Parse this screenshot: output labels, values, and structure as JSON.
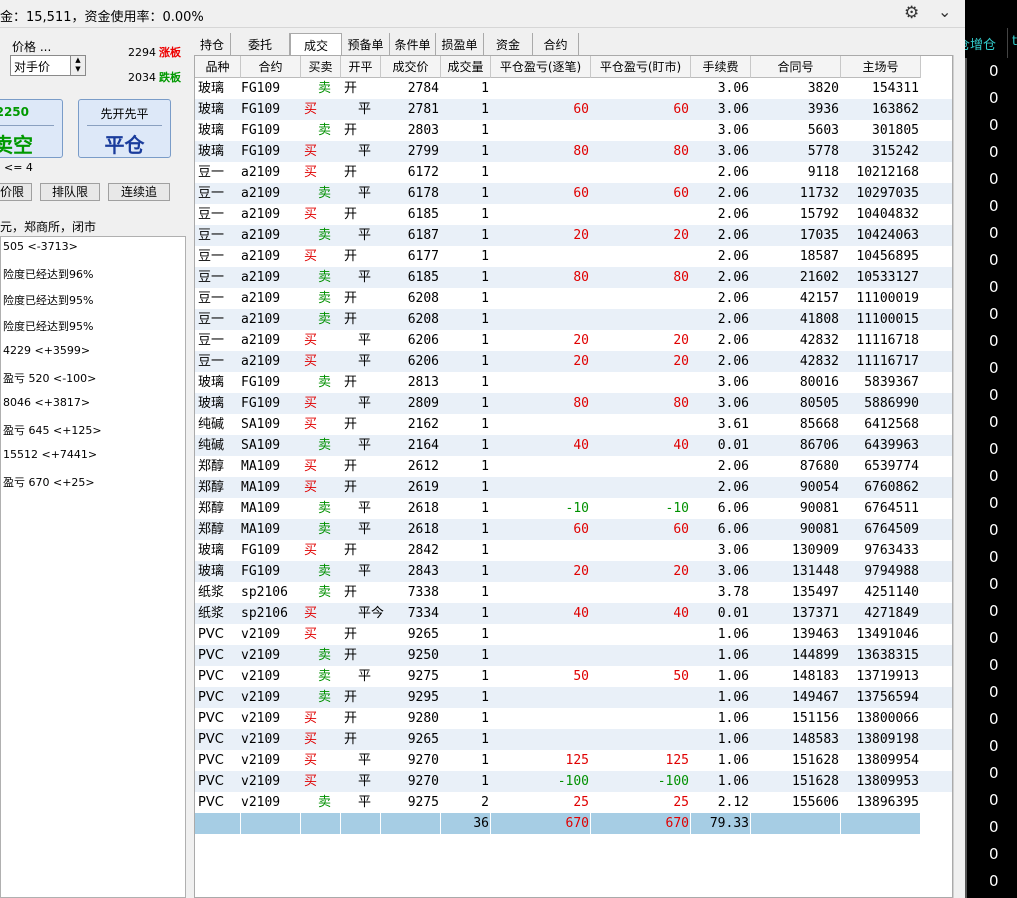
{
  "header": {
    "funds_text": "金：15,511，资金使用率：0.00%"
  },
  "order": {
    "price_label": "价格 ...",
    "price_type": "对手价",
    "limit_up_value": "2294",
    "limit_up_tag": "涨板",
    "limit_down_value": "2034",
    "limit_down_tag": "跌板",
    "sell_price": "2250",
    "sell_label": "卖空",
    "close_sub": "先开先平",
    "close_label": "平仓",
    "qty_hint": "<= 4",
    "btn_limit": "价限",
    "btn_queue": "排队限",
    "btn_chase": "连续追"
  },
  "log": {
    "header": "元，郑商所，闭市",
    "lines": [
      "505 <-3713>",
      "险度已经达到96%",
      "险度已经达到95%",
      "险度已经达到95%",
      "4229 <+3599>",
      "盈亏 520 <-100>",
      "8046 <+3817>",
      "盈亏 645 <+125>",
      "15512 <+7441>",
      "盈亏 670 <+25>"
    ]
  },
  "tabs": [
    "持仓",
    "委托",
    "成交",
    "预备单",
    "条件单",
    "损盈单",
    "资金",
    "合约"
  ],
  "active_tab": "成交",
  "columns": [
    "品种",
    "合约",
    "买卖",
    "开平",
    "成交价",
    "成交量",
    "平仓盈亏(逐笔)",
    "平仓盈亏(盯市)",
    "手续费",
    "合同号",
    "主场号"
  ],
  "rows": [
    [
      "玻璃",
      "FG109",
      "卖",
      "开",
      "2784",
      "1",
      "",
      "",
      "3.06",
      "3820",
      "154311"
    ],
    [
      "玻璃",
      "FG109",
      "买",
      "平",
      "2781",
      "1",
      "60",
      "60",
      "3.06",
      "3936",
      "163862"
    ],
    [
      "玻璃",
      "FG109",
      "卖",
      "开",
      "2803",
      "1",
      "",
      "",
      "3.06",
      "5603",
      "301805"
    ],
    [
      "玻璃",
      "FG109",
      "买",
      "平",
      "2799",
      "1",
      "80",
      "80",
      "3.06",
      "5778",
      "315242"
    ],
    [
      "豆一",
      "a2109",
      "买",
      "开",
      "6172",
      "1",
      "",
      "",
      "2.06",
      "9118",
      "10212168"
    ],
    [
      "豆一",
      "a2109",
      "卖",
      "平",
      "6178",
      "1",
      "60",
      "60",
      "2.06",
      "11732",
      "10297035"
    ],
    [
      "豆一",
      "a2109",
      "买",
      "开",
      "6185",
      "1",
      "",
      "",
      "2.06",
      "15792",
      "10404832"
    ],
    [
      "豆一",
      "a2109",
      "卖",
      "平",
      "6187",
      "1",
      "20",
      "20",
      "2.06",
      "17035",
      "10424063"
    ],
    [
      "豆一",
      "a2109",
      "买",
      "开",
      "6177",
      "1",
      "",
      "",
      "2.06",
      "18587",
      "10456895"
    ],
    [
      "豆一",
      "a2109",
      "卖",
      "平",
      "6185",
      "1",
      "80",
      "80",
      "2.06",
      "21602",
      "10533127"
    ],
    [
      "豆一",
      "a2109",
      "卖",
      "开",
      "6208",
      "1",
      "",
      "",
      "2.06",
      "42157",
      "11100019"
    ],
    [
      "豆一",
      "a2109",
      "卖",
      "开",
      "6208",
      "1",
      "",
      "",
      "2.06",
      "41808",
      "11100015"
    ],
    [
      "豆一",
      "a2109",
      "买",
      "平",
      "6206",
      "1",
      "20",
      "20",
      "2.06",
      "42832",
      "11116718"
    ],
    [
      "豆一",
      "a2109",
      "买",
      "平",
      "6206",
      "1",
      "20",
      "20",
      "2.06",
      "42832",
      "11116717"
    ],
    [
      "玻璃",
      "FG109",
      "卖",
      "开",
      "2813",
      "1",
      "",
      "",
      "3.06",
      "80016",
      "5839367"
    ],
    [
      "玻璃",
      "FG109",
      "买",
      "平",
      "2809",
      "1",
      "80",
      "80",
      "3.06",
      "80505",
      "5886990"
    ],
    [
      "纯碱",
      "SA109",
      "买",
      "开",
      "2162",
      "1",
      "",
      "",
      "3.61",
      "85668",
      "6412568"
    ],
    [
      "纯碱",
      "SA109",
      "卖",
      "平",
      "2164",
      "1",
      "40",
      "40",
      "0.01",
      "86706",
      "6439963"
    ],
    [
      "郑醇",
      "MA109",
      "买",
      "开",
      "2612",
      "1",
      "",
      "",
      "2.06",
      "87680",
      "6539774"
    ],
    [
      "郑醇",
      "MA109",
      "买",
      "开",
      "2619",
      "1",
      "",
      "",
      "2.06",
      "90054",
      "6760862"
    ],
    [
      "郑醇",
      "MA109",
      "卖",
      "平",
      "2618",
      "1",
      "-10",
      "-10",
      "6.06",
      "90081",
      "6764511"
    ],
    [
      "郑醇",
      "MA109",
      "卖",
      "平",
      "2618",
      "1",
      "60",
      "60",
      "6.06",
      "90081",
      "6764509"
    ],
    [
      "玻璃",
      "FG109",
      "买",
      "开",
      "2842",
      "1",
      "",
      "",
      "3.06",
      "130909",
      "9763433"
    ],
    [
      "玻璃",
      "FG109",
      "卖",
      "平",
      "2843",
      "1",
      "20",
      "20",
      "3.06",
      "131448",
      "9794988"
    ],
    [
      "纸浆",
      "sp2106",
      "卖",
      "开",
      "7338",
      "1",
      "",
      "",
      "3.78",
      "135497",
      "4251140"
    ],
    [
      "纸浆",
      "sp2106",
      "买",
      "平今",
      "7334",
      "1",
      "40",
      "40",
      "0.01",
      "137371",
      "4271849"
    ],
    [
      "PVC",
      "v2109",
      "买",
      "开",
      "9265",
      "1",
      "",
      "",
      "1.06",
      "139463",
      "13491046"
    ],
    [
      "PVC",
      "v2109",
      "卖",
      "开",
      "9250",
      "1",
      "",
      "",
      "1.06",
      "144899",
      "13638315"
    ],
    [
      "PVC",
      "v2109",
      "卖",
      "平",
      "9275",
      "1",
      "50",
      "50",
      "1.06",
      "148183",
      "13719913"
    ],
    [
      "PVC",
      "v2109",
      "卖",
      "开",
      "9295",
      "1",
      "",
      "",
      "1.06",
      "149467",
      "13756594"
    ],
    [
      "PVC",
      "v2109",
      "买",
      "开",
      "9280",
      "1",
      "",
      "",
      "1.06",
      "151156",
      "13800066"
    ],
    [
      "PVC",
      "v2109",
      "买",
      "开",
      "9265",
      "1",
      "",
      "",
      "1.06",
      "148583",
      "13809198"
    ],
    [
      "PVC",
      "v2109",
      "买",
      "平",
      "9270",
      "1",
      "125",
      "125",
      "1.06",
      "151628",
      "13809954"
    ],
    [
      "PVC",
      "v2109",
      "买",
      "平",
      "9270",
      "1",
      "-100",
      "-100",
      "1.06",
      "151628",
      "13809953"
    ],
    [
      "PVC",
      "v2109",
      "卖",
      "平",
      "9275",
      "2",
      "25",
      "25",
      "2.12",
      "155606",
      "13896395"
    ]
  ],
  "totals": {
    "volume": "36",
    "pnl_trade": "670",
    "pnl_mtm": "670",
    "fee": "79.33"
  },
  "right_panel": {
    "header": "仓增仓",
    "header_extra": "t",
    "zero_value": "0",
    "zero_count": 31
  },
  "colors": {
    "buy": "#e00000",
    "sell": "#009000",
    "total_row": "#a6cde4",
    "alt_row": "#e9f0f8"
  }
}
